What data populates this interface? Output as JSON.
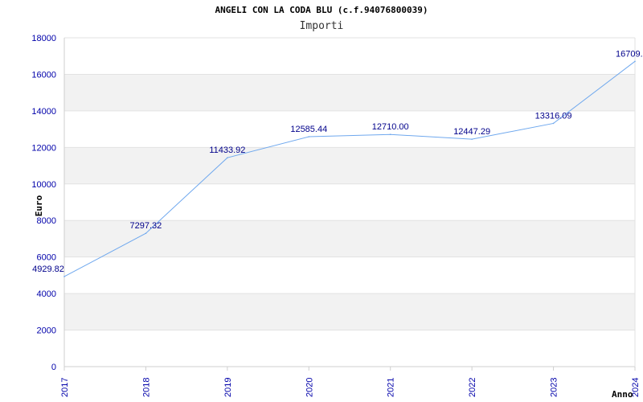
{
  "chart_data": {
    "type": "line",
    "title": "ANGELI CON LA CODA BLU (c.f.94076800039)",
    "subtitle": "Importi",
    "xlabel": "Anno",
    "ylabel": "Euro",
    "ylim": [
      0,
      18000
    ],
    "yticks": [
      0,
      2000,
      4000,
      6000,
      8000,
      10000,
      12000,
      14000,
      16000,
      18000
    ],
    "categories": [
      "2017",
      "2018",
      "2019",
      "2020",
      "2021",
      "2022",
      "2023",
      "2024"
    ],
    "values": [
      4929.82,
      7297.32,
      11433.92,
      12585.44,
      12710.0,
      12447.29,
      13316.09,
      16709
    ],
    "labels": [
      "4929.82",
      "7297.32",
      "11433.92",
      "12585.44",
      "12710.00",
      "12447.29",
      "13316.09",
      "16709."
    ],
    "line_color": "#6fa8ee",
    "band_color": "#f2f2f2",
    "grid": true
  }
}
